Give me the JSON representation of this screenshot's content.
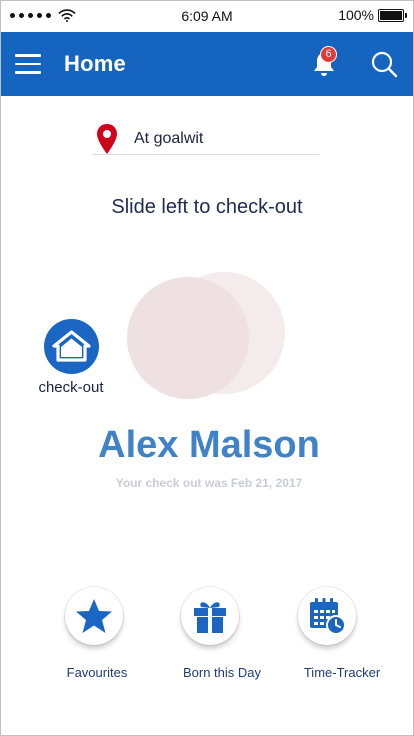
{
  "status_bar": {
    "time": "6:09 AM",
    "battery": "100%",
    "battery_level": 1.0
  },
  "app_bar": {
    "title": "Home",
    "notification_count": "6"
  },
  "location": {
    "text": "At goalwit"
  },
  "instruction": "Slide left to check-out",
  "checkout": {
    "label": "check-out"
  },
  "user": {
    "name": "Alex Malson",
    "status": "Your check out was Feb 21, 2017"
  },
  "actions": [
    {
      "label": "Favourites",
      "icon": "star-icon"
    },
    {
      "label": "Born this Day",
      "icon": "gift-icon"
    },
    {
      "label": "Time-Tracker",
      "icon": "calendar-clock-icon"
    }
  ],
  "colors": {
    "primary": "#1565c0",
    "accent_text": "#3f82c8",
    "badge": "#e53935",
    "pin": "#d0021b"
  }
}
